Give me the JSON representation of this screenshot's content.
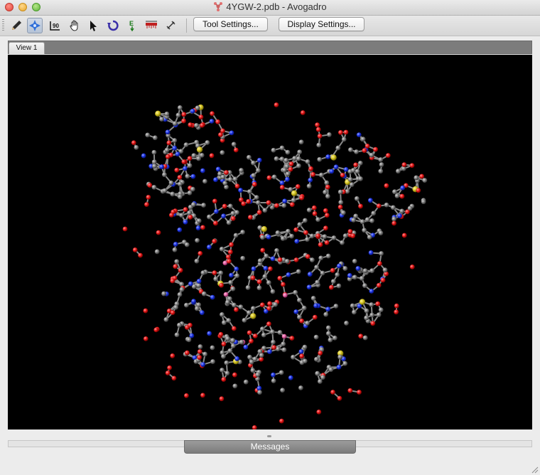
{
  "window": {
    "title": "4YGW-2.pdb - Avogadro"
  },
  "toolbar": {
    "tools": [
      {
        "name": "draw-tool",
        "icon": "pencil-icon"
      },
      {
        "name": "navigate-tool",
        "icon": "navigate-cross-icon",
        "active": true
      },
      {
        "name": "bond-centric-tool",
        "icon": "bond-angle-icon",
        "label": "90"
      },
      {
        "name": "manipulate-tool",
        "icon": "hand-icon"
      },
      {
        "name": "select-tool",
        "icon": "arrow-cursor-icon"
      },
      {
        "name": "auto-rotate-tool",
        "icon": "rotate-icon"
      },
      {
        "name": "auto-optimize-tool",
        "icon": "optimize-energy-icon",
        "label": "E"
      },
      {
        "name": "measure-tool",
        "icon": "ruler-icon"
      },
      {
        "name": "align-tool",
        "icon": "align-icon"
      }
    ],
    "tool_settings_label": "Tool Settings...",
    "display_settings_label": "Display Settings..."
  },
  "tabs": [
    {
      "label": "View 1",
      "active": true
    }
  ],
  "viewport": {
    "background": "#000000",
    "atom_colors": {
      "carbon": "#7a7a7a",
      "oxygen": "#e01414",
      "nitrogen": "#1830e0",
      "sulfur": "#d0c020",
      "other": "#e060a0"
    },
    "bond_color": "#8a8a8a"
  },
  "messages": {
    "label": "Messages"
  }
}
